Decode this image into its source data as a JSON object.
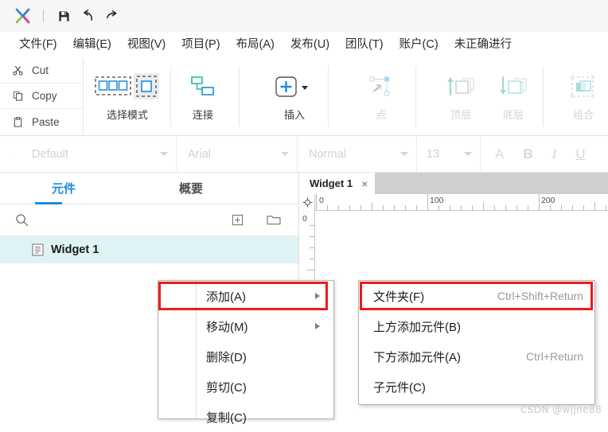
{
  "titlebar": {
    "logo": "axure-x-logo",
    "buttons": [
      {
        "name": "save-button",
        "icon": "save-icon",
        "label": "Save"
      },
      {
        "name": "undo-button",
        "icon": "undo-icon",
        "label": "Undo"
      },
      {
        "name": "redo-button",
        "icon": "redo-icon",
        "label": "Redo"
      }
    ]
  },
  "menubar": {
    "items": [
      {
        "label": "文件(F)",
        "name": "menu-file"
      },
      {
        "label": "编辑(E)",
        "name": "menu-edit"
      },
      {
        "label": "视图(V)",
        "name": "menu-view"
      },
      {
        "label": "项目(P)",
        "name": "menu-project"
      },
      {
        "label": "布局(A)",
        "name": "menu-layout"
      },
      {
        "label": "发布(U)",
        "name": "menu-publish"
      },
      {
        "label": "团队(T)",
        "name": "menu-team"
      },
      {
        "label": "账户(C)",
        "name": "menu-account"
      },
      {
        "label": "未正确进行",
        "name": "menu-status"
      }
    ]
  },
  "toolbar": {
    "clipboard": [
      {
        "label": "Cut",
        "icon": "scissors-icon",
        "name": "cut-command"
      },
      {
        "label": "Copy",
        "icon": "copy-icon",
        "name": "copy-command"
      },
      {
        "label": "Paste",
        "icon": "clipboard-icon",
        "name": "paste-command"
      }
    ],
    "groups": [
      {
        "label": "选择模式",
        "name": "select-mode",
        "icon": "selection-mode-icon",
        "enabled": true
      },
      {
        "label": "连接",
        "name": "connect",
        "icon": "connector-icon",
        "enabled": true
      },
      {
        "label": "插入",
        "name": "insert",
        "icon": "plus-box-icon",
        "enabled": true,
        "has_dropdown": true
      },
      {
        "label": "点",
        "name": "point",
        "icon": "point-edit-icon",
        "enabled": false
      },
      {
        "label": "顶层",
        "name": "bring-to-front",
        "icon": "arrow-up-layers-icon",
        "enabled": false
      },
      {
        "label": "底层",
        "name": "send-to-back",
        "icon": "arrow-down-layers-icon",
        "enabled": false
      },
      {
        "label": "组合",
        "name": "group",
        "icon": "group-icon",
        "enabled": false
      }
    ]
  },
  "formatbar": {
    "style_icon": "style-edit-icon",
    "style_value": "Default",
    "font_value": "Arial",
    "weight_value": "Normal",
    "size_value": "13",
    "text_color_icon": "A",
    "bold_icon": "B",
    "italic_icon": "I",
    "underline_icon": "U"
  },
  "left_panel": {
    "tabs": [
      {
        "label": "元件",
        "name": "tab-widgets",
        "active": true
      },
      {
        "label": "概要",
        "name": "tab-outline",
        "active": false
      }
    ],
    "search_icon": "search-icon",
    "add_icon": "add-page-icon",
    "folder_icon": "folder-icon",
    "tree": [
      {
        "label": "Widget 1",
        "icon": "page-icon",
        "selected": true
      }
    ]
  },
  "canvas": {
    "tab_label": "Widget 1",
    "tab_close": "×",
    "ruler_origin_icon": "origin-crosshair-icon",
    "ruler_h_labels": [
      "0",
      "100",
      "200"
    ],
    "ruler_v_labels": [
      "0"
    ]
  },
  "context_menu": {
    "items": [
      {
        "label": "添加(A)",
        "name": "ctx-add",
        "submenu": true,
        "highlighted": true
      },
      {
        "label": "移动(M)",
        "name": "ctx-move",
        "submenu": true,
        "highlighted": false
      },
      {
        "label": "删除(D)",
        "name": "ctx-delete",
        "submenu": false,
        "highlighted": false
      },
      {
        "label": "剪切(C)",
        "name": "ctx-cut",
        "submenu": false,
        "highlighted": false
      },
      {
        "label": "复制(C)",
        "name": "ctx-copy",
        "submenu": false,
        "highlighted": false
      }
    ]
  },
  "submenu": {
    "items": [
      {
        "label": "文件夹(F)",
        "shortcut": "Ctrl+Shift+Return",
        "name": "sub-folder",
        "highlighted": true
      },
      {
        "label": "上方添加元件(B)",
        "shortcut": "",
        "name": "sub-add-above",
        "highlighted": false
      },
      {
        "label": "下方添加元件(A)",
        "shortcut": "Ctrl+Return",
        "name": "sub-add-below",
        "highlighted": false
      },
      {
        "label": "子元件(C)",
        "shortcut": "",
        "name": "sub-child",
        "highlighted": false
      }
    ]
  },
  "watermark": "CSDN @wjjne88",
  "colors": {
    "accent": "#1c8ce0",
    "highlight_red": "#ef1b1b",
    "selected_row": "#dff3f4",
    "titlebar_bg": "#f6f6f6",
    "tabstrip_bg": "#cfcfcf"
  }
}
